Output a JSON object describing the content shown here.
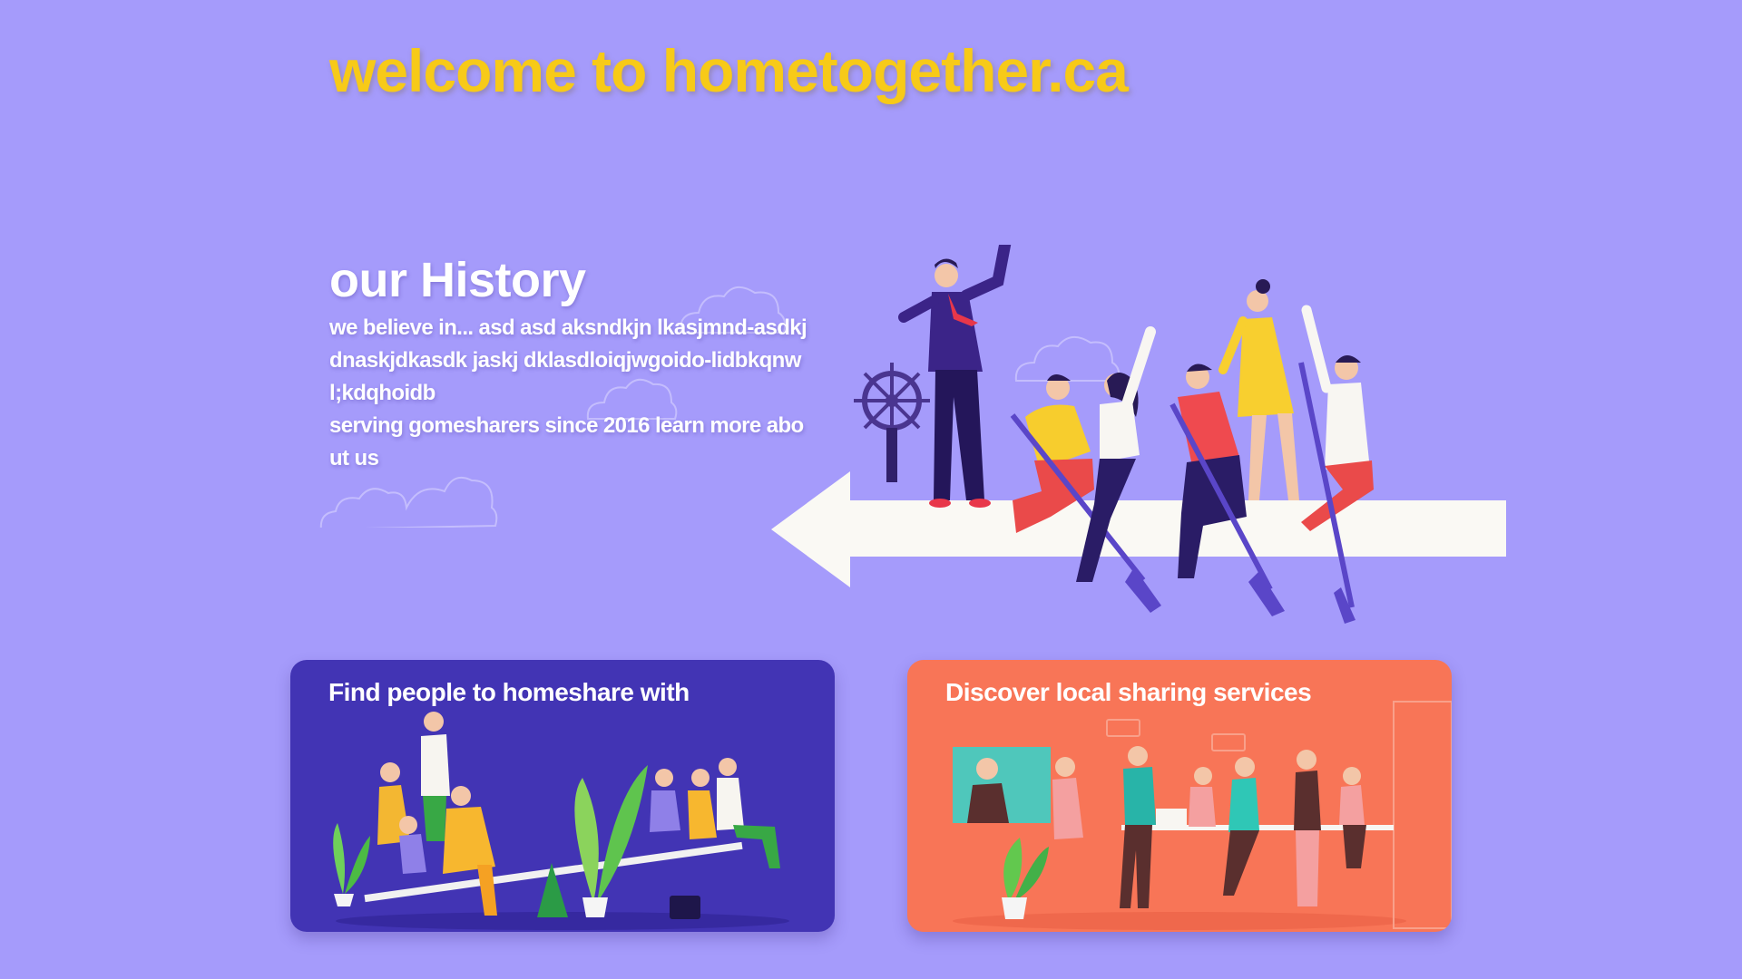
{
  "header": {
    "title": "welcome to hometogether.ca"
  },
  "history": {
    "heading": "our History",
    "paragraph_1": "we believe in... asd asd aksndkjn lkasjmnd-asdkj dnaskjdkasdk jaskj dklasdloiqjwgoido-lidbkqnwl;kdqhoidb",
    "paragraph_2_text": "serving gomesharers since 2016 ",
    "learn_more_link": "learn more about us"
  },
  "cards": [
    {
      "label": "Find people to homeshare with",
      "color": "#4234b4"
    },
    {
      "label": "Discover local sharing services",
      "color": "#f87557"
    }
  ],
  "colors": {
    "background": "#a59bfb",
    "title_accent": "#f7ca18"
  }
}
